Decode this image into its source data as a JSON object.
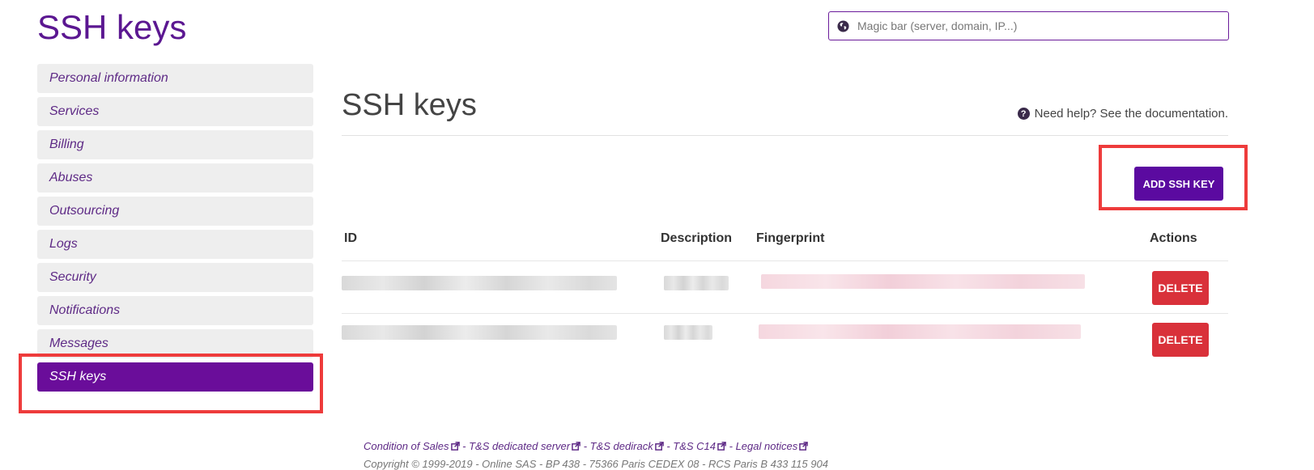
{
  "header": {
    "title": "SSH keys",
    "magic_bar": {
      "placeholder": "Magic bar (server, domain, IP...)",
      "value": "",
      "icon": "globe-icon"
    }
  },
  "sidebar": {
    "items": [
      {
        "label": "Personal information",
        "active": false
      },
      {
        "label": "Services",
        "active": false
      },
      {
        "label": "Billing",
        "active": false
      },
      {
        "label": "Abuses",
        "active": false
      },
      {
        "label": "Outsourcing",
        "active": false
      },
      {
        "label": "Logs",
        "active": false
      },
      {
        "label": "Security",
        "active": false
      },
      {
        "label": "Notifications",
        "active": false
      },
      {
        "label": "Messages",
        "active": false
      },
      {
        "label": "SSH keys",
        "active": true
      }
    ]
  },
  "main": {
    "title": "SSH keys",
    "help_text": "Need help? See the documentation.",
    "help_icon": "question-circle-icon",
    "add_button": "ADD SSH KEY",
    "table": {
      "headers": {
        "id": "ID",
        "description": "Description",
        "fingerprint": "Fingerprint",
        "actions": "Actions"
      },
      "rows": [
        {
          "id": "",
          "description": "",
          "fingerprint": "",
          "action": "DELETE"
        },
        {
          "id": "",
          "description": "",
          "fingerprint": "",
          "action": "DELETE"
        }
      ]
    }
  },
  "footer": {
    "links": [
      "Condition of Sales",
      "T&S dedicated server",
      "T&S dedirack",
      "T&S C14",
      "Legal notices"
    ],
    "separator": " - ",
    "copyright": "Copyright © 1999-2019 - Online SAS - BP 438 - 75366 Paris CEDEX 08 - RCS Paris B 433 115 904"
  },
  "colors": {
    "brand_purple": "#5b1791",
    "active_purple": "#6a0d9a",
    "danger_red": "#d9313a",
    "highlight_red": "#ee3b3b"
  }
}
